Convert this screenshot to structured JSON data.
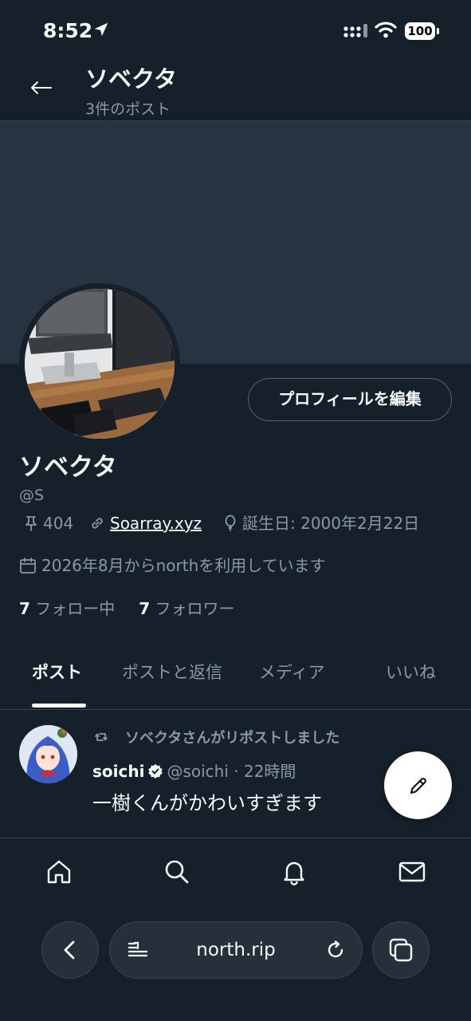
{
  "status_bar": {
    "time": "8:52",
    "battery": "100"
  },
  "header": {
    "title": "ソベクタ",
    "post_count": "3件のポスト"
  },
  "profile": {
    "display_name": "ソベクタ",
    "handle": "@S",
    "edit_button": "プロフィールを編集",
    "pinned_value": "404",
    "website": "Soarray.xyz",
    "birthday": "誕生日: 2000年2月22日",
    "joined": "2026年8月からnorthを利用しています",
    "following_count": "7",
    "following_label": " フォロー中",
    "followers_count": "7",
    "followers_label": " フォロワー"
  },
  "tabs": [
    {
      "label": "ポスト",
      "active": true
    },
    {
      "label": "ポストと返信",
      "active": false
    },
    {
      "label": "メディア",
      "active": false
    },
    {
      "label": "いいね",
      "active": false
    }
  ],
  "post": {
    "repost_note": "ソベクタさんがリポストしました",
    "author_name": "soichi",
    "author_meta": "@soichi · 22時間",
    "text": "一樹くんがかわいすぎます"
  },
  "bottom_nav": [
    "home-icon",
    "search-icon",
    "bell-icon",
    "mail-icon"
  ],
  "browser": {
    "url": "north.rip"
  },
  "colors": {
    "background": "#15202b",
    "banner": "#273340",
    "muted_text": "#8b98a5",
    "border": "#38444d"
  }
}
